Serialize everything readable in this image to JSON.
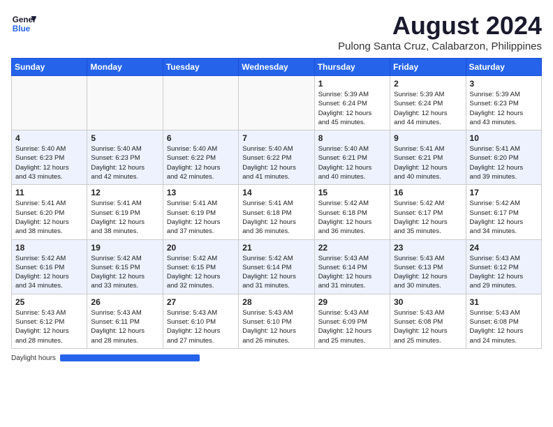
{
  "logo": {
    "line1": "General",
    "line2": "Blue"
  },
  "title": "August 2024",
  "location": "Pulong Santa Cruz, Calabarzon, Philippines",
  "days_of_week": [
    "Sunday",
    "Monday",
    "Tuesday",
    "Wednesday",
    "Thursday",
    "Friday",
    "Saturday"
  ],
  "weeks": [
    [
      {
        "day": "",
        "info": ""
      },
      {
        "day": "",
        "info": ""
      },
      {
        "day": "",
        "info": ""
      },
      {
        "day": "",
        "info": ""
      },
      {
        "day": "1",
        "info": "Sunrise: 5:39 AM\nSunset: 6:24 PM\nDaylight: 12 hours\nand 45 minutes."
      },
      {
        "day": "2",
        "info": "Sunrise: 5:39 AM\nSunset: 6:24 PM\nDaylight: 12 hours\nand 44 minutes."
      },
      {
        "day": "3",
        "info": "Sunrise: 5:39 AM\nSunset: 6:23 PM\nDaylight: 12 hours\nand 43 minutes."
      }
    ],
    [
      {
        "day": "4",
        "info": "Sunrise: 5:40 AM\nSunset: 6:23 PM\nDaylight: 12 hours\nand 43 minutes."
      },
      {
        "day": "5",
        "info": "Sunrise: 5:40 AM\nSunset: 6:23 PM\nDaylight: 12 hours\nand 42 minutes."
      },
      {
        "day": "6",
        "info": "Sunrise: 5:40 AM\nSunset: 6:22 PM\nDaylight: 12 hours\nand 42 minutes."
      },
      {
        "day": "7",
        "info": "Sunrise: 5:40 AM\nSunset: 6:22 PM\nDaylight: 12 hours\nand 41 minutes."
      },
      {
        "day": "8",
        "info": "Sunrise: 5:40 AM\nSunset: 6:21 PM\nDaylight: 12 hours\nand 40 minutes."
      },
      {
        "day": "9",
        "info": "Sunrise: 5:41 AM\nSunset: 6:21 PM\nDaylight: 12 hours\nand 40 minutes."
      },
      {
        "day": "10",
        "info": "Sunrise: 5:41 AM\nSunset: 6:20 PM\nDaylight: 12 hours\nand 39 minutes."
      }
    ],
    [
      {
        "day": "11",
        "info": "Sunrise: 5:41 AM\nSunset: 6:20 PM\nDaylight: 12 hours\nand 38 minutes."
      },
      {
        "day": "12",
        "info": "Sunrise: 5:41 AM\nSunset: 6:19 PM\nDaylight: 12 hours\nand 38 minutes."
      },
      {
        "day": "13",
        "info": "Sunrise: 5:41 AM\nSunset: 6:19 PM\nDaylight: 12 hours\nand 37 minutes."
      },
      {
        "day": "14",
        "info": "Sunrise: 5:41 AM\nSunset: 6:18 PM\nDaylight: 12 hours\nand 36 minutes."
      },
      {
        "day": "15",
        "info": "Sunrise: 5:42 AM\nSunset: 6:18 PM\nDaylight: 12 hours\nand 36 minutes."
      },
      {
        "day": "16",
        "info": "Sunrise: 5:42 AM\nSunset: 6:17 PM\nDaylight: 12 hours\nand 35 minutes."
      },
      {
        "day": "17",
        "info": "Sunrise: 5:42 AM\nSunset: 6:17 PM\nDaylight: 12 hours\nand 34 minutes."
      }
    ],
    [
      {
        "day": "18",
        "info": "Sunrise: 5:42 AM\nSunset: 6:16 PM\nDaylight: 12 hours\nand 34 minutes."
      },
      {
        "day": "19",
        "info": "Sunrise: 5:42 AM\nSunset: 6:15 PM\nDaylight: 12 hours\nand 33 minutes."
      },
      {
        "day": "20",
        "info": "Sunrise: 5:42 AM\nSunset: 6:15 PM\nDaylight: 12 hours\nand 32 minutes."
      },
      {
        "day": "21",
        "info": "Sunrise: 5:42 AM\nSunset: 6:14 PM\nDaylight: 12 hours\nand 31 minutes."
      },
      {
        "day": "22",
        "info": "Sunrise: 5:43 AM\nSunset: 6:14 PM\nDaylight: 12 hours\nand 31 minutes."
      },
      {
        "day": "23",
        "info": "Sunrise: 5:43 AM\nSunset: 6:13 PM\nDaylight: 12 hours\nand 30 minutes."
      },
      {
        "day": "24",
        "info": "Sunrise: 5:43 AM\nSunset: 6:12 PM\nDaylight: 12 hours\nand 29 minutes."
      }
    ],
    [
      {
        "day": "25",
        "info": "Sunrise: 5:43 AM\nSunset: 6:12 PM\nDaylight: 12 hours\nand 28 minutes."
      },
      {
        "day": "26",
        "info": "Sunrise: 5:43 AM\nSunset: 6:11 PM\nDaylight: 12 hours\nand 28 minutes."
      },
      {
        "day": "27",
        "info": "Sunrise: 5:43 AM\nSunset: 6:10 PM\nDaylight: 12 hours\nand 27 minutes."
      },
      {
        "day": "28",
        "info": "Sunrise: 5:43 AM\nSunset: 6:10 PM\nDaylight: 12 hours\nand 26 minutes."
      },
      {
        "day": "29",
        "info": "Sunrise: 5:43 AM\nSunset: 6:09 PM\nDaylight: 12 hours\nand 25 minutes."
      },
      {
        "day": "30",
        "info": "Sunrise: 5:43 AM\nSunset: 6:08 PM\nDaylight: 12 hours\nand 25 minutes."
      },
      {
        "day": "31",
        "info": "Sunrise: 5:43 AM\nSunset: 6:08 PM\nDaylight: 12 hours\nand 24 minutes."
      }
    ]
  ],
  "daylight_label": "Daylight hours",
  "colors": {
    "header_bg": "#2563eb",
    "accent": "#2563eb"
  }
}
